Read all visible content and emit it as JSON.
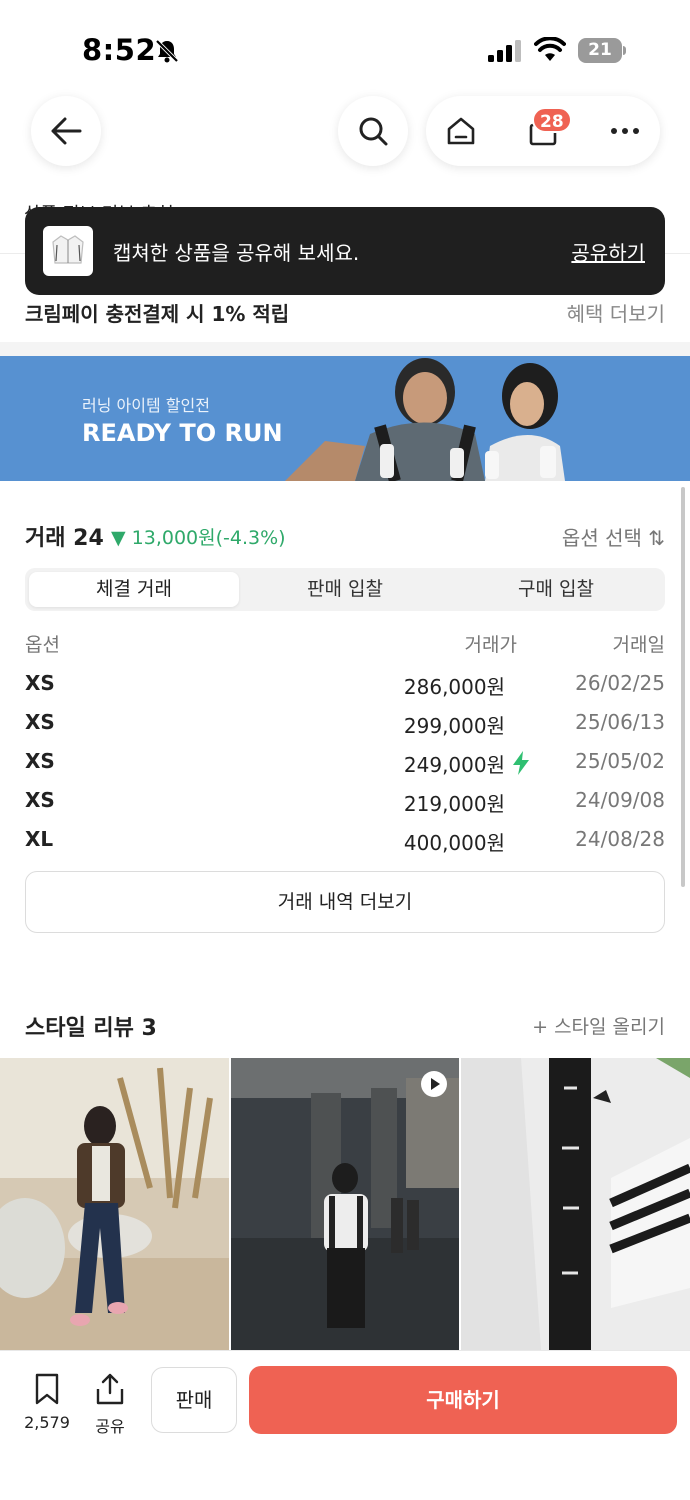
{
  "status": {
    "time": "8:52",
    "battery": "21"
  },
  "nav": {
    "cart_count": "28"
  },
  "behind_toast": {
    "text": "상품 정보 리뷰 추천"
  },
  "toast": {
    "message": "캡쳐한 상품을 공유해 보세요.",
    "action": "공유하기"
  },
  "benefit": {
    "label": "크림페이 충전결제 시 1% 적립",
    "more": "혜택 더보기"
  },
  "banner": {
    "subtitle": "러닝 아이템 할인전",
    "title": "READY TO RUN"
  },
  "trades": {
    "title": "거래 24",
    "change": "▼ 13,000원(-4.3%)",
    "option_select": "옵션 선택 ⇅",
    "tabs": [
      {
        "label": "체결 거래",
        "active": true
      },
      {
        "label": "판매 입찰",
        "active": false
      },
      {
        "label": "구매 입찰",
        "active": false
      }
    ],
    "headers": {
      "option": "옵션",
      "price": "거래가",
      "date": "거래일"
    },
    "rows": [
      {
        "size": "XS",
        "price": "286,000원",
        "date": "26/02/25",
        "quick": false
      },
      {
        "size": "XS",
        "price": "299,000원",
        "date": "25/06/13",
        "quick": false
      },
      {
        "size": "XS",
        "price": "249,000원",
        "date": "25/05/02",
        "quick": true
      },
      {
        "size": "XS",
        "price": "219,000원",
        "date": "24/09/08",
        "quick": false
      },
      {
        "size": "XL",
        "price": "400,000원",
        "date": "24/08/28",
        "quick": false
      }
    ],
    "more_button": "거래 내역 더보기"
  },
  "style_review": {
    "title": "스타일 리뷰 3",
    "upload": "+ 스타일 올리기"
  },
  "bottom": {
    "bookmark_count": "2,579",
    "share_label": "공유",
    "sell_label": "판매",
    "buy_label": "구매하기"
  },
  "colors": {
    "accent": "#ef6253",
    "price_down": "#2fa96a",
    "banner_bg": "#5791d1"
  }
}
